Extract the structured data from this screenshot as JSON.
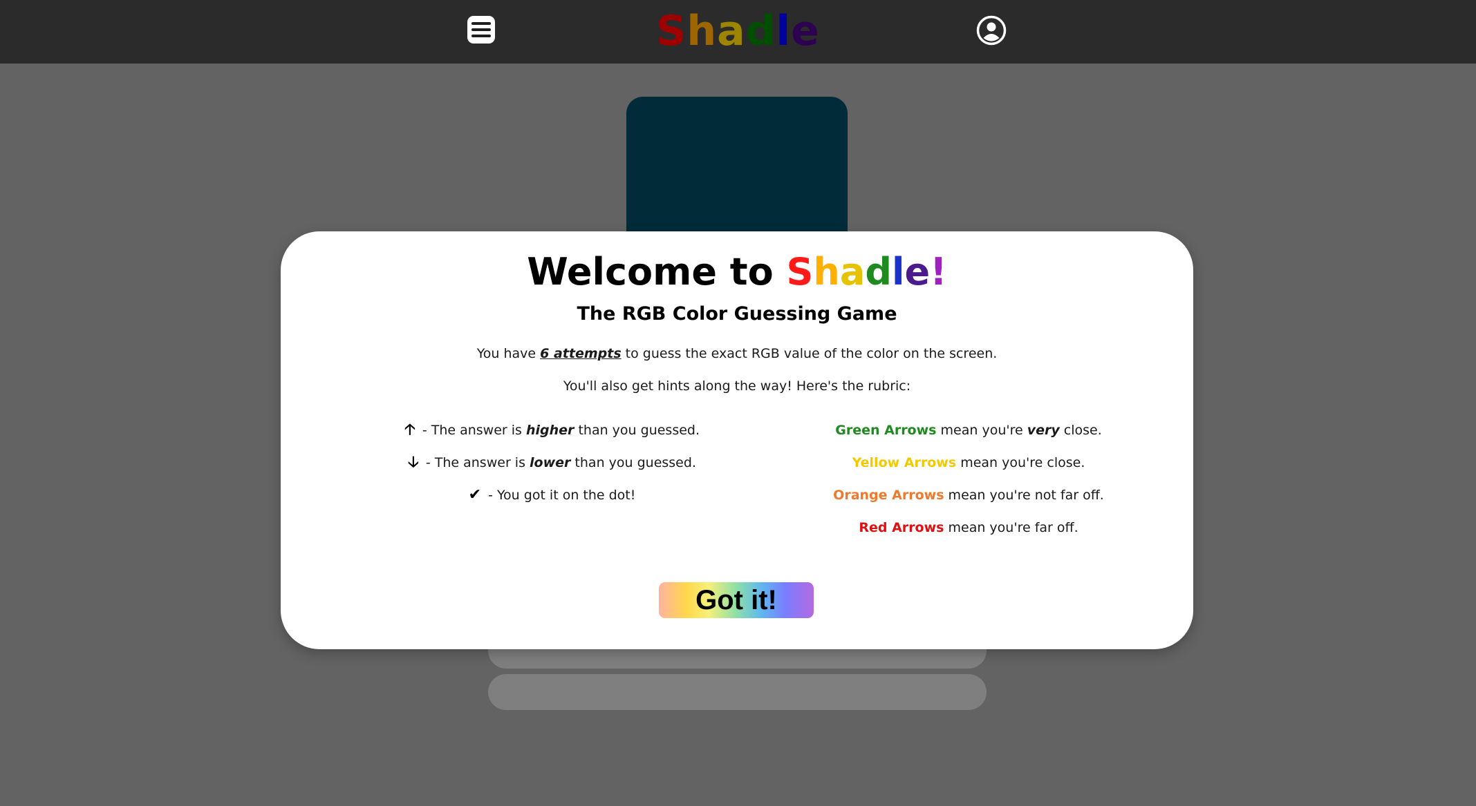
{
  "header": {
    "logo_letters": [
      {
        "char": "S",
        "color": "#ff0000"
      },
      {
        "char": "h",
        "color": "#ffa500"
      },
      {
        "char": "a",
        "color": "#ffd700"
      },
      {
        "char": "d",
        "color": "#008000"
      },
      {
        "char": "l",
        "color": "#0000ff"
      },
      {
        "char": "e",
        "color": "#4b0082"
      }
    ],
    "menu_icon": "hamburger-menu-icon",
    "user_icon": "user-account-icon"
  },
  "game": {
    "target_color": "#022b3a"
  },
  "modal": {
    "title_prefix": "Welcome to ",
    "title_letters": [
      {
        "char": "S",
        "color": "#ff1a1a"
      },
      {
        "char": "h",
        "color": "#ffb000"
      },
      {
        "char": "a",
        "color": "#e6c200"
      },
      {
        "char": "d",
        "color": "#1f8a1f"
      },
      {
        "char": "l",
        "color": "#1a33cc"
      },
      {
        "char": "e",
        "color": "#4b1a8c"
      },
      {
        "char": "!",
        "color": "#a020c0"
      }
    ],
    "subtitle": "The RGB Color Guessing Game",
    "intro_before": "You have ",
    "intro_emphasis": "6 attempts",
    "intro_after": " to guess the exact RGB value of the color on the screen.",
    "hints_line": "You'll also get hints along the way! Here's the rubric:",
    "rubric_left": [
      {
        "icon": "arrow-up-icon",
        "glyph": "🡡",
        "before": " - The answer is ",
        "emphasis": "higher",
        "after": " than you guessed."
      },
      {
        "icon": "arrow-down-icon",
        "glyph": "🡣",
        "before": " - The answer is ",
        "emphasis": "lower",
        "after": " than you guessed."
      },
      {
        "icon": "checkmark-icon",
        "glyph": "✔",
        "before": " - You got it on the dot!",
        "emphasis": "",
        "after": ""
      }
    ],
    "rubric_right": [
      {
        "label": "Green Arrows",
        "color": "#1f8a1f",
        "before": " mean you're ",
        "emphasis": "very",
        "after": " close."
      },
      {
        "label": "Yellow Arrows",
        "color": "#f2c900",
        "before": " mean you're close.",
        "emphasis": "",
        "after": ""
      },
      {
        "label": "Orange Arrows",
        "color": "#f07a2a",
        "before": " mean you're not far off.",
        "emphasis": "",
        "after": ""
      },
      {
        "label": "Red Arrows",
        "color": "#e01010",
        "before": " mean you're far off.",
        "emphasis": "",
        "after": ""
      }
    ],
    "button_label": "Got it!"
  }
}
